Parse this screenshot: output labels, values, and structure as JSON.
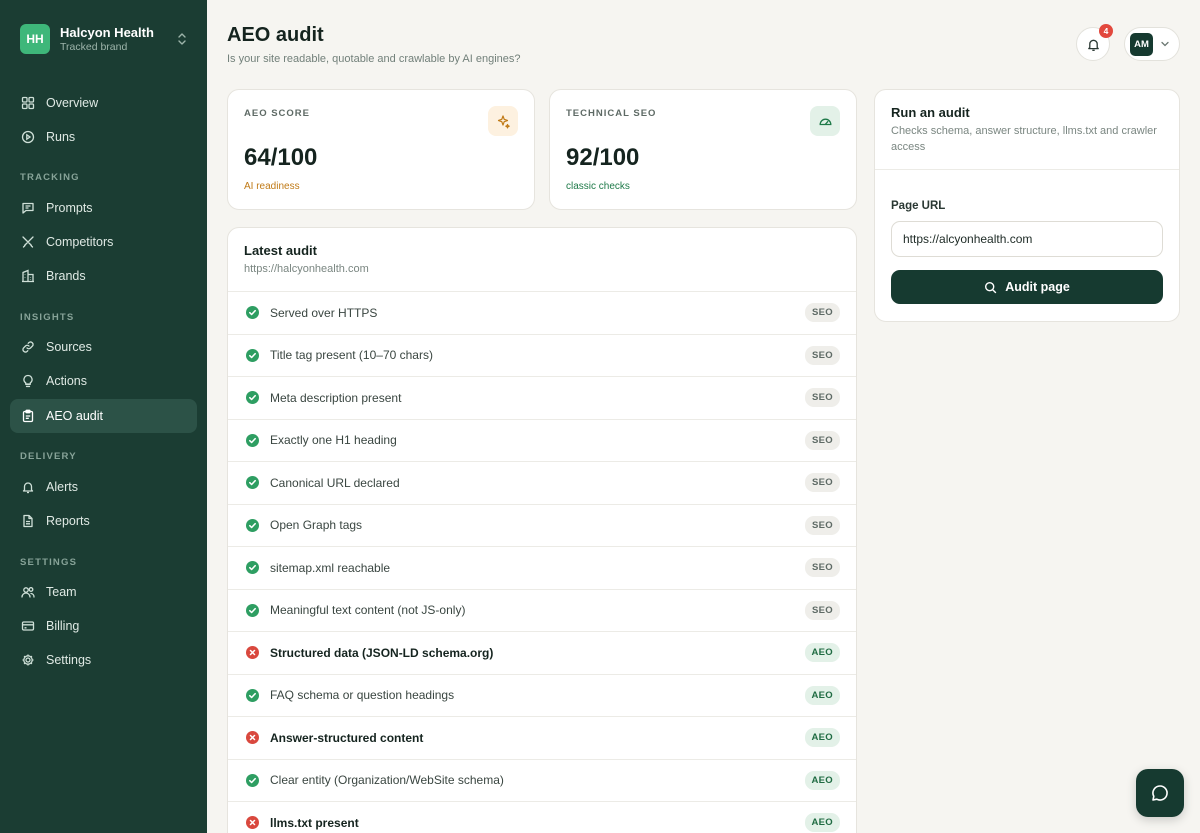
{
  "brand": {
    "initials": "HH",
    "name": "Halcyon Health",
    "subtitle": "Tracked brand"
  },
  "nav": {
    "top": [
      {
        "label": "Overview",
        "icon": "grid-icon"
      },
      {
        "label": "Runs",
        "icon": "play-circle-icon"
      }
    ],
    "sections": [
      {
        "title": "TRACKING",
        "items": [
          {
            "label": "Prompts",
            "icon": "message-square-icon"
          },
          {
            "label": "Competitors",
            "icon": "swords-icon"
          },
          {
            "label": "Brands",
            "icon": "building-icon"
          }
        ]
      },
      {
        "title": "INSIGHTS",
        "items": [
          {
            "label": "Sources",
            "icon": "link-icon"
          },
          {
            "label": "Actions",
            "icon": "lightbulb-icon"
          },
          {
            "label": "AEO audit",
            "icon": "clipboard-icon",
            "active": true
          }
        ]
      },
      {
        "title": "DELIVERY",
        "items": [
          {
            "label": "Alerts",
            "icon": "bell-icon"
          },
          {
            "label": "Reports",
            "icon": "file-icon"
          }
        ]
      },
      {
        "title": "SETTINGS",
        "items": [
          {
            "label": "Team",
            "icon": "users-icon"
          },
          {
            "label": "Billing",
            "icon": "credit-card-icon"
          },
          {
            "label": "Settings",
            "icon": "gear-icon"
          }
        ]
      }
    ]
  },
  "header": {
    "title": "AEO audit",
    "subtitle": "Is your site readable, quotable and crawlable by AI engines?",
    "notifications": "4",
    "user_initials": "AM"
  },
  "stats": {
    "aeo": {
      "label": "AEO SCORE",
      "value": "64/100",
      "note": "AI readiness",
      "note_color": "#c07a16"
    },
    "seo": {
      "label": "TECHNICAL SEO",
      "value": "92/100",
      "note": "classic checks",
      "note_color": "#1f7a49"
    }
  },
  "audit": {
    "title": "Latest audit",
    "url": "https://halcyonhealth.com",
    "checks": [
      {
        "label": "Served over HTTPS",
        "status": "pass",
        "tag": "SEO"
      },
      {
        "label": "Title tag present (10–70 chars)",
        "status": "pass",
        "tag": "SEO"
      },
      {
        "label": "Meta description present",
        "status": "pass",
        "tag": "SEO"
      },
      {
        "label": "Exactly one H1 heading",
        "status": "pass",
        "tag": "SEO"
      },
      {
        "label": "Canonical URL declared",
        "status": "pass",
        "tag": "SEO"
      },
      {
        "label": "Open Graph tags",
        "status": "pass",
        "tag": "SEO"
      },
      {
        "label": "sitemap.xml reachable",
        "status": "pass",
        "tag": "SEO"
      },
      {
        "label": "Meaningful text content (not JS-only)",
        "status": "pass",
        "tag": "SEO"
      },
      {
        "label": "Structured data (JSON-LD schema.org)",
        "status": "fail",
        "tag": "AEO"
      },
      {
        "label": "FAQ schema or question headings",
        "status": "pass",
        "tag": "AEO"
      },
      {
        "label": "Answer-structured content",
        "status": "fail",
        "tag": "AEO"
      },
      {
        "label": "Clear entity (Organization/WebSite schema)",
        "status": "pass",
        "tag": "AEO"
      },
      {
        "label": "llms.txt present",
        "status": "fail",
        "tag": "AEO"
      }
    ]
  },
  "run": {
    "title": "Run an audit",
    "description": "Checks schema, answer structure, llms.txt and crawler access",
    "url_label": "Page URL",
    "url_value": "https://alcyonhealth.com",
    "button": "Audit page"
  },
  "colors": {
    "sidebar": "#1b3d33",
    "accent": "#163a30",
    "pass": "#2e9e62",
    "fail": "#d9483e"
  }
}
